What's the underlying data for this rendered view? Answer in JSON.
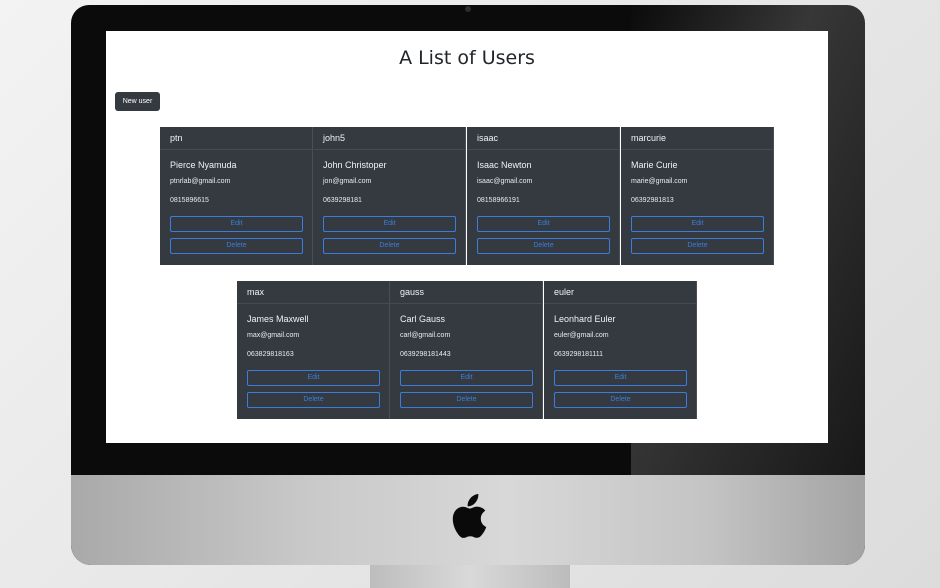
{
  "page": {
    "title": "A List of Users",
    "new_user_label": "New user"
  },
  "users": [
    {
      "username": "ptn",
      "name": "Pierce Nyamuda",
      "email": "ptnrlab@gmail.com",
      "phone": "0815896615",
      "edit_label": "Edit",
      "delete_label": "Delete"
    },
    {
      "username": "john5",
      "name": "John Christoper",
      "email": "jon@gmail.com",
      "phone": "0639298181",
      "edit_label": "Edit",
      "delete_label": "Delete"
    },
    {
      "username": "isaac",
      "name": "Isaac Newton",
      "email": "isaac@gmail.com",
      "phone": "08158966191",
      "edit_label": "Edit",
      "delete_label": "Delete"
    },
    {
      "username": "marcurie",
      "name": "Marie Curie",
      "email": "marie@gmail.com",
      "phone": "06392981813",
      "edit_label": "Edit",
      "delete_label": "Delete"
    },
    {
      "username": "max",
      "name": "James Maxwell",
      "email": "max@gmail.com",
      "phone": "063829818163",
      "edit_label": "Edit",
      "delete_label": "Delete"
    },
    {
      "username": "gauss",
      "name": "Carl Gauss",
      "email": "carl@gmail.com",
      "phone": "0639298181443",
      "edit_label": "Edit",
      "delete_label": "Delete"
    },
    {
      "username": "euler",
      "name": "Leonhard Euler",
      "email": "euler@gmail.com",
      "phone": "0639298181111",
      "edit_label": "Edit",
      "delete_label": "Delete"
    }
  ],
  "colors": {
    "card_bg": "#343a40",
    "button_outline": "#3b7ddd",
    "new_user_bg": "#343a40"
  },
  "icons": {
    "brand": "apple-logo"
  }
}
